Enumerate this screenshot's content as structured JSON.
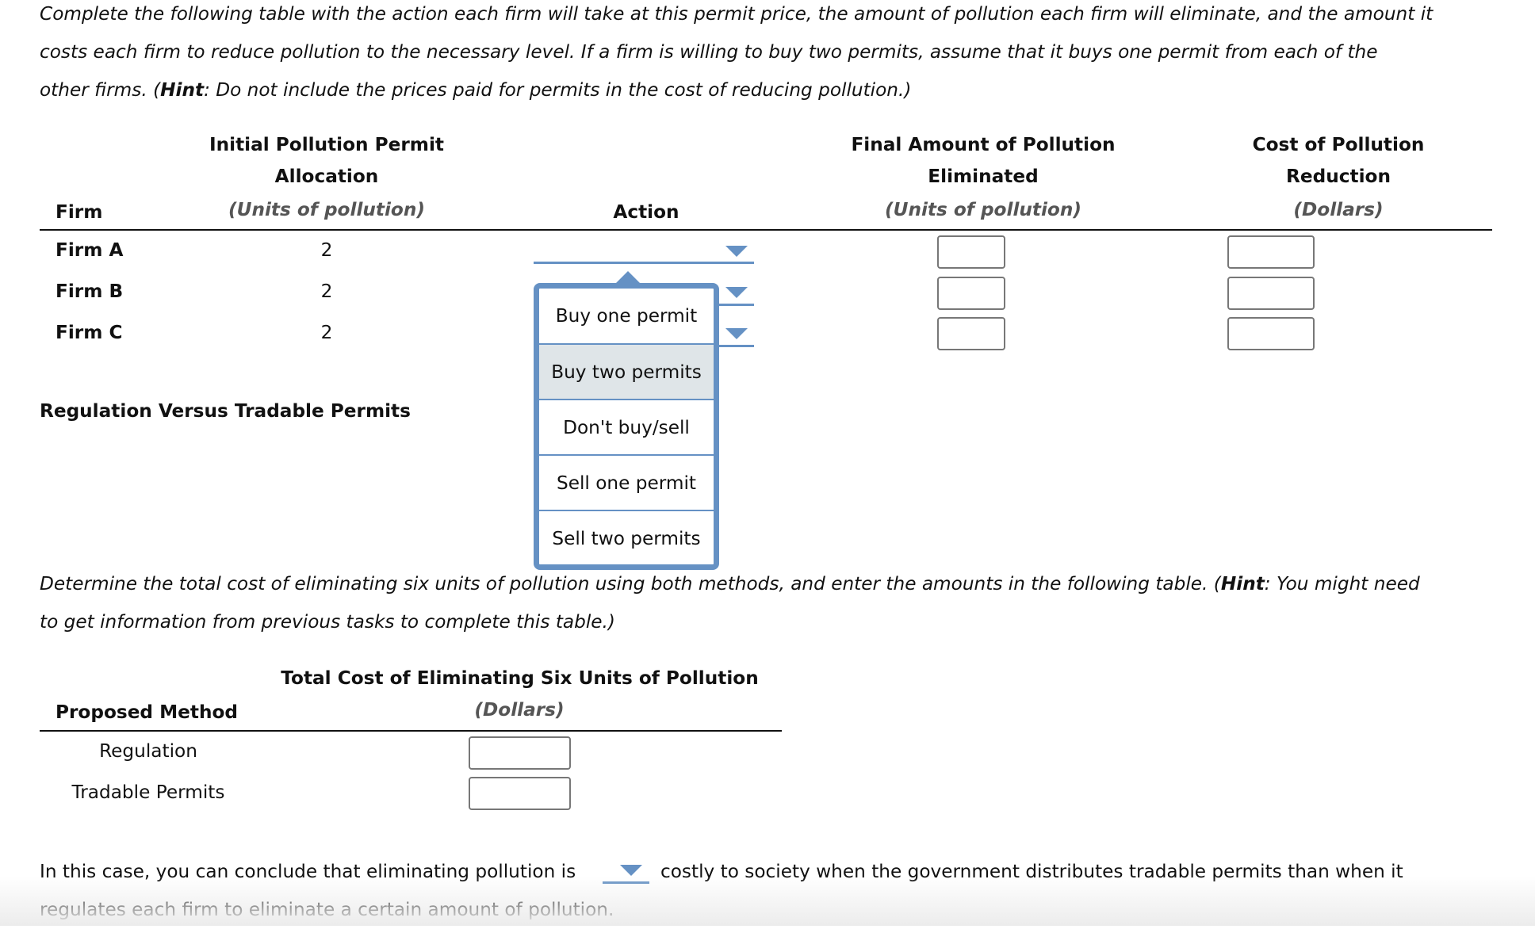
{
  "instructions": {
    "line1": "Complete the following table with the action each firm will take at this permit price, the amount of pollution each firm will eliminate, and the amount it",
    "line2": "costs each firm to reduce pollution to the necessary level. If a firm is willing to buy two permits, assume that it buys one permit from each of the",
    "line3_pre": "other firms. (",
    "line3_hint": "Hint",
    "line3_post": ": Do not include the prices paid for permits in the cost of reducing pollution.)"
  },
  "permit_table": {
    "headers": {
      "firm": "Firm",
      "allocation_line1": "Initial Pollution Permit",
      "allocation_line2": "Allocation",
      "allocation_unit": "(Units of pollution)",
      "action": "Action",
      "eliminated_line1": "Final Amount of Pollution",
      "eliminated_line2": "Eliminated",
      "eliminated_unit": "(Units of pollution)",
      "cost_line1": "Cost of Pollution",
      "cost_line2": "Reduction",
      "cost_unit": "(Dollars)"
    },
    "rows": [
      {
        "firm": "Firm A",
        "allocation": "2",
        "action": "",
        "eliminated": "",
        "cost": ""
      },
      {
        "firm": "Firm B",
        "allocation": "2",
        "action": "",
        "eliminated": "",
        "cost": ""
      },
      {
        "firm": "Firm C",
        "allocation": "2",
        "action": "",
        "eliminated": "",
        "cost": ""
      }
    ],
    "action_dropdown": {
      "open_for": "Firm A",
      "highlighted": "Buy two permits",
      "options": [
        "Buy one permit",
        "Buy two permits",
        "Don't buy/sell",
        "Sell one permit",
        "Sell two permits"
      ]
    }
  },
  "section_title": "Regulation Versus Tradable Permits",
  "instructions2": {
    "line1_pre": "Determine the total cost of eliminating six units of pollution using both methods, and enter the amounts in the following table. (",
    "line1_hint": "Hint",
    "line1_post": ": You might need",
    "line2": "to get information from previous tasks to complete this table.)"
  },
  "cost_table": {
    "headers": {
      "method": "Proposed Method",
      "total_line1": "Total Cost of Eliminating Six Units of Pollution",
      "total_unit": "(Dollars)"
    },
    "rows": [
      {
        "method": "Regulation",
        "value": ""
      },
      {
        "method": "Tradable Permits",
        "value": ""
      }
    ]
  },
  "conclusion": {
    "pre": "In this case, you can conclude that eliminating pollution is",
    "selected": "",
    "post": "costly to society when the government distributes tradable permits than when it",
    "line2": "regulates each firm to eliminate a certain amount of pollution."
  },
  "colors": {
    "dropdown_accent": "#6591c4",
    "highlight": "#dfe5e8",
    "unit_text": "#555555"
  }
}
